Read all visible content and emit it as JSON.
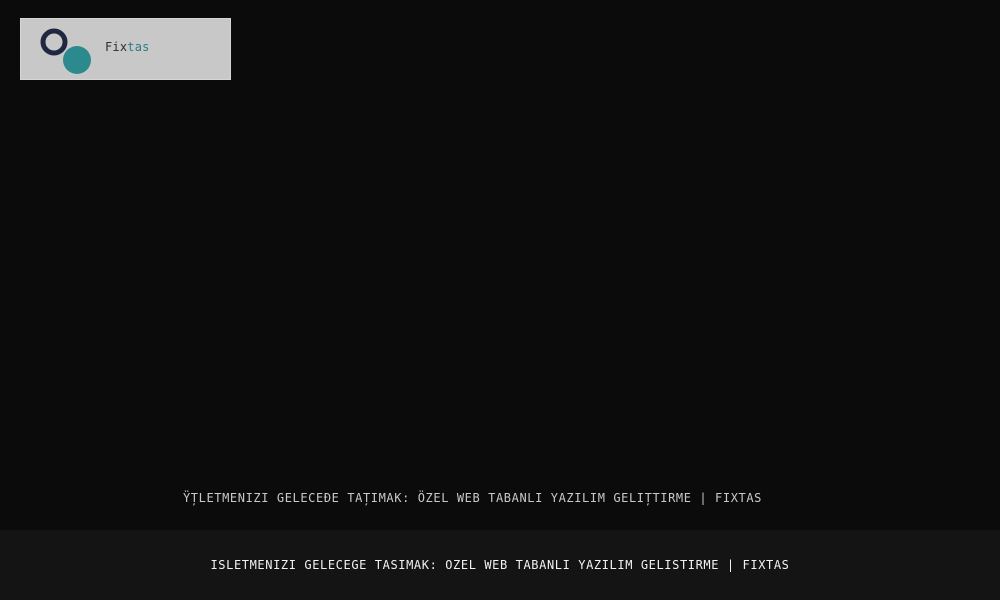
{
  "logo": {
    "wordmark_part1": "Fix",
    "wordmark_part2": "tas",
    "icon": "two-circles-logo-icon",
    "colors": {
      "background": "#c8c8c8",
      "ring": "#1f2840",
      "dot": "#2c8a8f",
      "text_dark": "#2a2d33",
      "text_accent": "#2c7c82"
    }
  },
  "page": {
    "title": "ŸȚLETMENIZI GELECEĐE TAȚIMAK: ÖZEL WEB TABANLI YAZILIM GELIȚTIRME | FIXTAS"
  },
  "footer": {
    "title": "ISLETMENIZI GELECEGE TASIMAK: OZEL WEB TABANLI YAZILIM GELISTIRME | FIXTAS"
  },
  "colors": {
    "page_background": "#0b0b0b",
    "footer_background": "#141414"
  }
}
